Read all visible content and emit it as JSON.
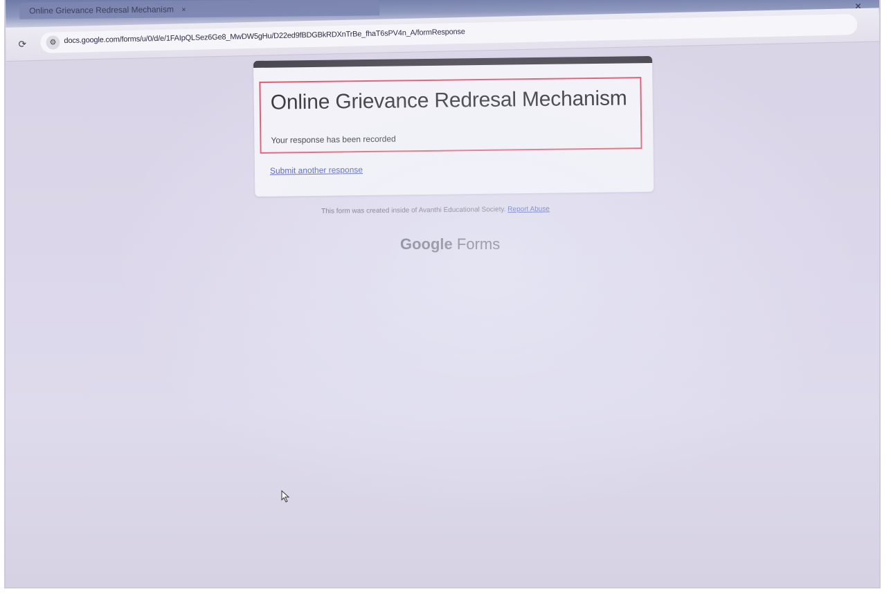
{
  "browser": {
    "tab_label": "Online Grievance Redresal Mechanism",
    "tab_close": "×",
    "window_close": "×",
    "reload_icon": "⟳",
    "site_info_icon": "⚙",
    "url": "docs.google.com/forms/u/0/d/e/1FAIpQLSez6Ge8_MwDW5gHu/D22ed9fBDGBkRDXnTrBe_fhaT6sPV4n_A/formResponse"
  },
  "form": {
    "title": "Online Grievance Redresal Mechanism",
    "confirmation": "Your response has been recorded",
    "submit_another": "Submit another response",
    "accent_color": "#4a4650",
    "highlight_color": "#e0526a"
  },
  "footer": {
    "created_text": "This form was created inside of Avanthi Educational Society.",
    "report_abuse": "Report Abuse",
    "logo_brand": "Google",
    "logo_product": "Forms"
  }
}
